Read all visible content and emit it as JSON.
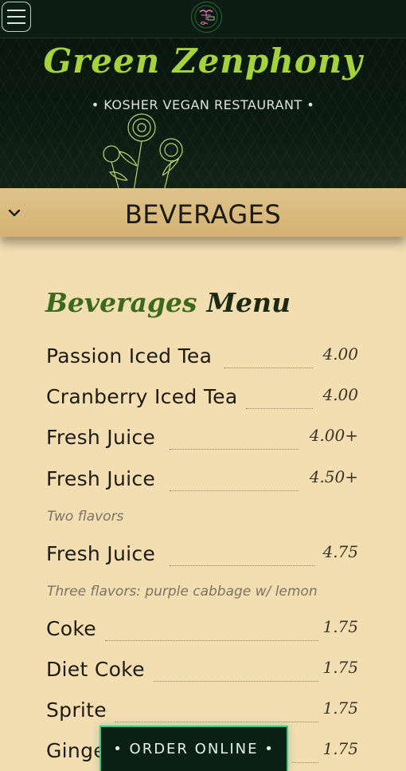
{
  "header": {
    "brand": "Green Zenphony",
    "tagline": "•  KOSHER  VEGAN  RESTAURANT  •"
  },
  "section": {
    "title": "BEVERAGES"
  },
  "menu": {
    "title_part1": "Beverages",
    "title_part2": "Menu",
    "items": [
      {
        "name": "Passion Iced Tea",
        "price": "4.00"
      },
      {
        "name": "Cranberry Iced Tea",
        "price": "4.00"
      },
      {
        "name": "Fresh Juice",
        "price": "4.00+"
      },
      {
        "name": "Fresh Juice",
        "price": "4.50+",
        "desc": "Two flavors"
      },
      {
        "name": "Fresh Juice",
        "price": "4.75",
        "desc": "Three flavors: purple cabbage w/ lemon"
      },
      {
        "name": "Coke",
        "price": "1.75"
      },
      {
        "name": "Diet Coke",
        "price": "1.75"
      },
      {
        "name": "Sprite",
        "price": "1.75"
      },
      {
        "name": "Ginger Ale",
        "price": "1.75"
      }
    ]
  },
  "order": {
    "label": "•  ORDER ONLINE  •"
  },
  "colors": {
    "brand_green": "#a6d23c",
    "cream": "#f3deb1",
    "bar_gold": "#d9bb80",
    "order_bg": "#0a2016",
    "order_border": "#3ec487"
  },
  "icons": [
    "hamburger-menu-icon",
    "restaurant-logo",
    "flower-illustration",
    "chevron-down-icon"
  ]
}
